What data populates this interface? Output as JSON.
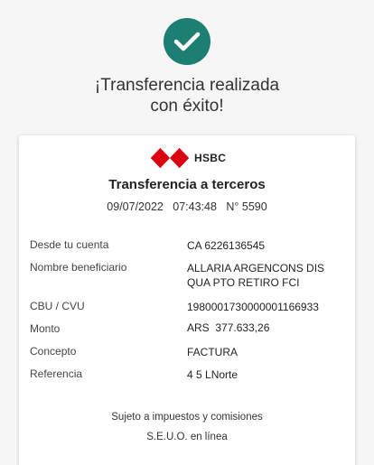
{
  "header": {
    "line1": "¡Transferencia realizada",
    "line2": "con éxito!"
  },
  "receipt": {
    "brand": "HSBC",
    "title": "Transferencia a terceros",
    "date": "09/07/2022",
    "time": "07:43:48",
    "number": "N° 5590",
    "rows": [
      {
        "label": "Desde tu cuenta",
        "value": "CA 6226136545"
      },
      {
        "label": "Nombre beneficiario",
        "value": "ALLARIA ARGENCONS DIS QUA PTO RETIRO FCI"
      },
      {
        "label": "CBU / CVU",
        "value": "1980001730000001166933"
      },
      {
        "label": "Monto",
        "value": "ARS  377.633,26"
      },
      {
        "label": "Concepto",
        "value": "FACTURA"
      },
      {
        "label": "Referencia",
        "value": "4 5 LNorte"
      }
    ],
    "footer1": "Sujeto a impuestos y comisiones",
    "footer2": "S.E.U.O. en línea"
  },
  "colors": {
    "success": "#1c7f72",
    "hsbc_red": "#db0011"
  },
  "icons": {
    "success": "check-icon",
    "brand": "hsbc-hexagon-logo"
  }
}
